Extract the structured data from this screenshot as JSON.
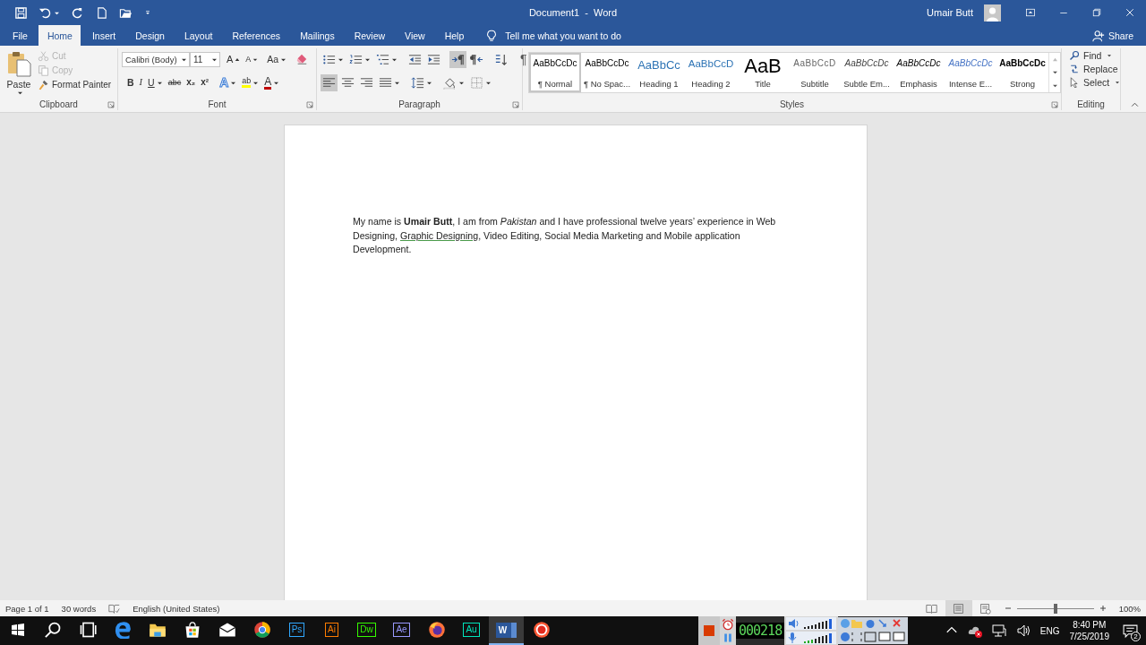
{
  "window": {
    "title": "Document1  -  Word",
    "user": "Umair Butt"
  },
  "quick_access": [
    {
      "kind": "save"
    },
    {
      "kind": "undo"
    },
    {
      "kind": "redo"
    },
    {
      "kind": "new"
    },
    {
      "kind": "open"
    },
    {
      "kind": "customize"
    }
  ],
  "tabs": [
    {
      "label": "File",
      "selected": false
    },
    {
      "label": "Home",
      "selected": true
    },
    {
      "label": "Insert",
      "selected": false
    },
    {
      "label": "Design",
      "selected": false
    },
    {
      "label": "Layout",
      "selected": false
    },
    {
      "label": "References",
      "selected": false
    },
    {
      "label": "Mailings",
      "selected": false
    },
    {
      "label": "Review",
      "selected": false
    },
    {
      "label": "View",
      "selected": false
    },
    {
      "label": "Help",
      "selected": false
    }
  ],
  "tell_me": "Tell me what you want to do",
  "share": "Share",
  "ribbon": {
    "clipboard": {
      "label": "Clipboard",
      "paste": "Paste",
      "items": [
        {
          "kind": "cut",
          "label": "Cut",
          "disabled": true
        },
        {
          "kind": "copy",
          "label": "Copy",
          "disabled": true
        },
        {
          "kind": "painter",
          "label": "Format Painter",
          "disabled": false
        }
      ]
    },
    "font": {
      "label": "Font",
      "font_name": "Calibri (Body)",
      "font_size": "11",
      "grow": "A",
      "shrink": "A",
      "change_case": "Aa",
      "buttons": [
        {
          "kind": "bold",
          "label": "B"
        },
        {
          "kind": "italic",
          "label": "I"
        },
        {
          "kind": "underline",
          "label": "U"
        },
        {
          "kind": "strike",
          "label": "abc"
        },
        {
          "kind": "sub",
          "label": "x₂"
        },
        {
          "kind": "sup",
          "label": "x²"
        },
        {
          "kind": "effects",
          "label": "A"
        },
        {
          "kind": "highlight",
          "label": "ab"
        },
        {
          "kind": "color",
          "label": "A"
        }
      ]
    },
    "paragraph": {
      "label": "Paragraph",
      "row1": [
        {
          "kind": "bullets",
          "selected": false
        },
        {
          "kind": "numbering",
          "selected": false
        },
        {
          "kind": "multilevel",
          "selected": false
        },
        {
          "kind": "outdent",
          "selected": false
        },
        {
          "kind": "indent",
          "selected": false
        },
        {
          "kind": "ltr",
          "selected": true
        },
        {
          "kind": "rtl",
          "selected": false
        },
        {
          "kind": "sort",
          "selected": false
        }
      ],
      "show_marks": "¶",
      "row2": [
        {
          "kind": "left",
          "selected": true
        },
        {
          "kind": "center",
          "selected": false
        },
        {
          "kind": "right",
          "selected": false
        },
        {
          "kind": "justify",
          "selected": false
        },
        {
          "kind": "spacing",
          "selected": false
        },
        {
          "kind": "shading",
          "selected": false
        },
        {
          "kind": "borders",
          "selected": false
        }
      ]
    },
    "styles": {
      "label": "Styles",
      "items": [
        {
          "preview": "AaBbCcDc",
          "name": "¶ Normal",
          "kind": "normal",
          "selected": true
        },
        {
          "preview": "AaBbCcDc",
          "name": "¶ No Spac...",
          "kind": "normal",
          "selected": false
        },
        {
          "preview": "AaBbCc",
          "name": "Heading 1",
          "kind": "heading1",
          "selected": false
        },
        {
          "preview": "AaBbCcD",
          "name": "Heading 2",
          "kind": "heading2",
          "selected": false
        },
        {
          "preview": "AaB",
          "name": "Title",
          "kind": "title",
          "selected": false
        },
        {
          "preview": "AaBbCcD",
          "name": "Subtitle",
          "kind": "subtitle",
          "selected": false
        },
        {
          "preview": "AaBbCcDc",
          "name": "Subtle Em...",
          "kind": "subtle",
          "selected": false
        },
        {
          "preview": "AaBbCcDc",
          "name": "Emphasis",
          "kind": "emphasis",
          "selected": false
        },
        {
          "preview": "AaBbCcDc",
          "name": "Intense E...",
          "kind": "intense",
          "selected": false
        },
        {
          "preview": "AaBbCcDc",
          "name": "Strong",
          "kind": "strong",
          "selected": false
        }
      ]
    },
    "editing": {
      "label": "Editing",
      "items": [
        {
          "kind": "find",
          "label": "Find"
        },
        {
          "kind": "replace",
          "label": "Replace"
        },
        {
          "kind": "select",
          "label": "Select"
        }
      ]
    }
  },
  "document": {
    "segments": [
      {
        "text": "My name is **Umair Butt**, I am from *Pakistan* and I have professional twelve years’ experience in Web Designing, ",
        "flagged": false
      },
      {
        "text": "Graphic Designing",
        "flagged": true
      },
      {
        "text": ", Video Editing, Social Media Marketing and Mobile application Development.",
        "flagged": false
      }
    ]
  },
  "status_bar": {
    "page": "Page 1 of 1",
    "words": "30 words",
    "language": "English (United States)",
    "views": [
      {
        "kind": "read",
        "selected": false
      },
      {
        "kind": "print",
        "selected": true
      },
      {
        "kind": "web",
        "selected": false
      }
    ],
    "zoom": {
      "level": 0.5,
      "reading": "100%"
    }
  },
  "taskbar": {
    "apps": [
      {
        "kind": "start",
        "selected": false
      },
      {
        "kind": "search",
        "selected": false
      },
      {
        "kind": "taskview",
        "selected": false
      },
      {
        "kind": "edge",
        "selected": false
      },
      {
        "kind": "explorer",
        "selected": false
      },
      {
        "kind": "store",
        "selected": false
      },
      {
        "kind": "mail",
        "selected": false
      },
      {
        "kind": "chrome",
        "selected": false
      },
      {
        "kind": "badge",
        "label": "Ps",
        "color": "#31a8ff",
        "selected": false
      },
      {
        "kind": "badge",
        "label": "Ai",
        "color": "#ff7c00",
        "selected": false
      },
      {
        "kind": "badge",
        "label": "Dw",
        "color": "#35fa00",
        "selected": false
      },
      {
        "kind": "badge",
        "label": "Ae",
        "color": "#9999ff",
        "selected": false
      },
      {
        "kind": "firefox",
        "selected": false
      },
      {
        "kind": "badge",
        "label": "Au",
        "color": "#00e4bb",
        "selected": false
      },
      {
        "kind": "word",
        "label": "W",
        "selected": true
      },
      {
        "kind": "recorder",
        "selected": false
      }
    ],
    "recorder": {
      "time": "000218"
    },
    "tray": {
      "language": "ENG",
      "time": "8:40 PM",
      "date": "7/25/2019",
      "notifications": "2"
    }
  }
}
